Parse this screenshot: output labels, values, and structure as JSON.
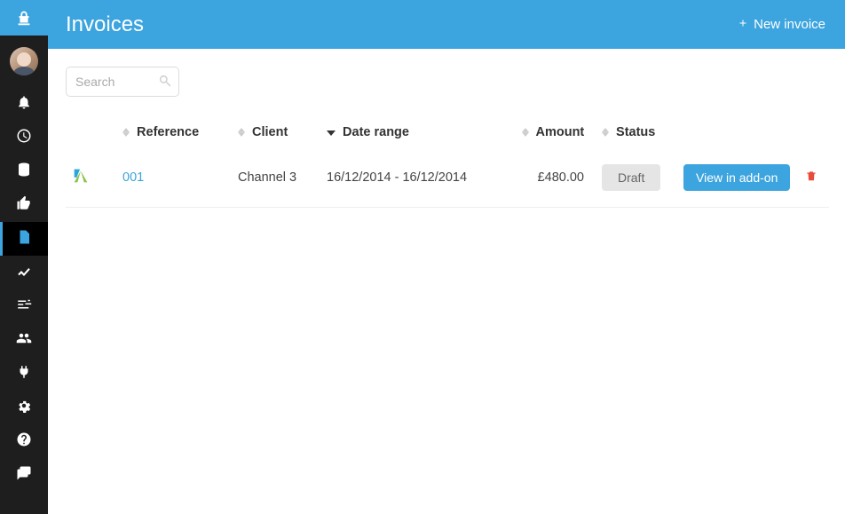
{
  "sidebar": {
    "items": [
      {
        "name": "nav-bell"
      },
      {
        "name": "nav-clock"
      },
      {
        "name": "nav-database"
      },
      {
        "name": "nav-thumbsup"
      },
      {
        "name": "nav-invoices",
        "active": true
      },
      {
        "name": "nav-analytics"
      },
      {
        "name": "nav-sliders"
      },
      {
        "name": "nav-users"
      },
      {
        "name": "nav-plug"
      },
      {
        "name": "nav-settings"
      },
      {
        "name": "nav-help"
      },
      {
        "name": "nav-chat"
      }
    ]
  },
  "header": {
    "title": "Invoices",
    "new_button": "New invoice"
  },
  "search": {
    "placeholder": "Search",
    "value": ""
  },
  "table": {
    "columns": {
      "reference": "Reference",
      "client": "Client",
      "date_range": "Date range",
      "amount": "Amount",
      "status": "Status"
    },
    "sort_active": "date_range",
    "rows": [
      {
        "logo": "channel-logo",
        "reference": "001",
        "client": "Channel 3",
        "date_range": "16/12/2014 - 16/12/2014",
        "amount": "£480.00",
        "status": "Draft",
        "action": "View in add-on"
      }
    ]
  }
}
